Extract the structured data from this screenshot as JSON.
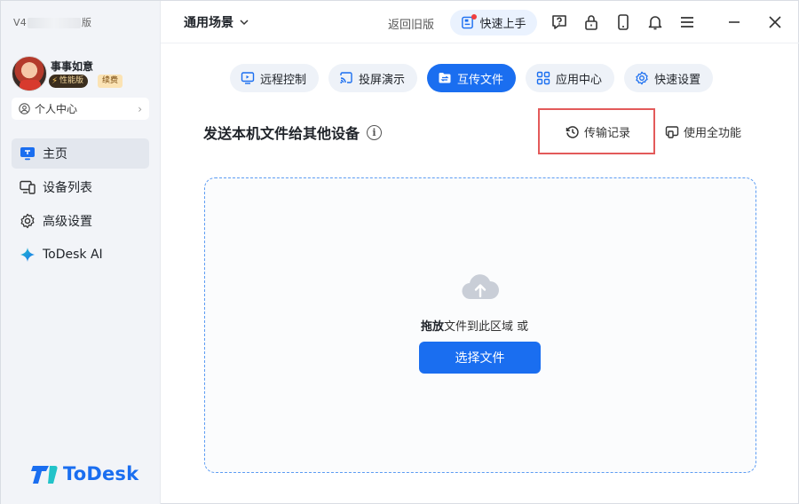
{
  "sidebar": {
    "version_prefix": "V4",
    "version_suffix": "版",
    "user": {
      "name": "事事如意",
      "badge_performance": "性能版",
      "badge_renew": "续费"
    },
    "personal_center": "个人中心",
    "nav": [
      {
        "label": "主页",
        "icon": "monitor-icon",
        "active": true
      },
      {
        "label": "设备列表",
        "icon": "devices-icon",
        "active": false
      },
      {
        "label": "高级设置",
        "icon": "gear-icon",
        "active": false
      },
      {
        "label": "ToDesk AI",
        "icon": "sparkle-icon",
        "active": false
      }
    ],
    "logo_text": "ToDesk"
  },
  "topbar": {
    "scene": "通用场景",
    "old_version": "返回旧版",
    "quick_start": "快速上手",
    "icons": [
      "help-icon",
      "lock-icon",
      "phone-icon",
      "bell-icon",
      "menu-icon",
      "minimize-icon",
      "close-icon"
    ]
  },
  "tabs": [
    {
      "label": "远程控制",
      "icon": "remote-control-icon",
      "active": false
    },
    {
      "label": "投屏演示",
      "icon": "cast-icon",
      "active": false
    },
    {
      "label": "互传文件",
      "icon": "file-transfer-icon",
      "active": true
    },
    {
      "label": "应用中心",
      "icon": "apps-icon",
      "active": false
    },
    {
      "label": "快速设置",
      "icon": "gear-icon",
      "active": false
    }
  ],
  "content": {
    "title": "发送本机文件给其他设备",
    "transfer_record": "传输记录",
    "full_features": "使用全功能",
    "drop_bold": "拖放",
    "drop_rest": "文件到此区域 或",
    "choose_file": "选择文件"
  },
  "colors": {
    "accent": "#1a6ef0",
    "highlight_box": "#e35a5a",
    "sidebar_bg": "#f2f4f8"
  }
}
